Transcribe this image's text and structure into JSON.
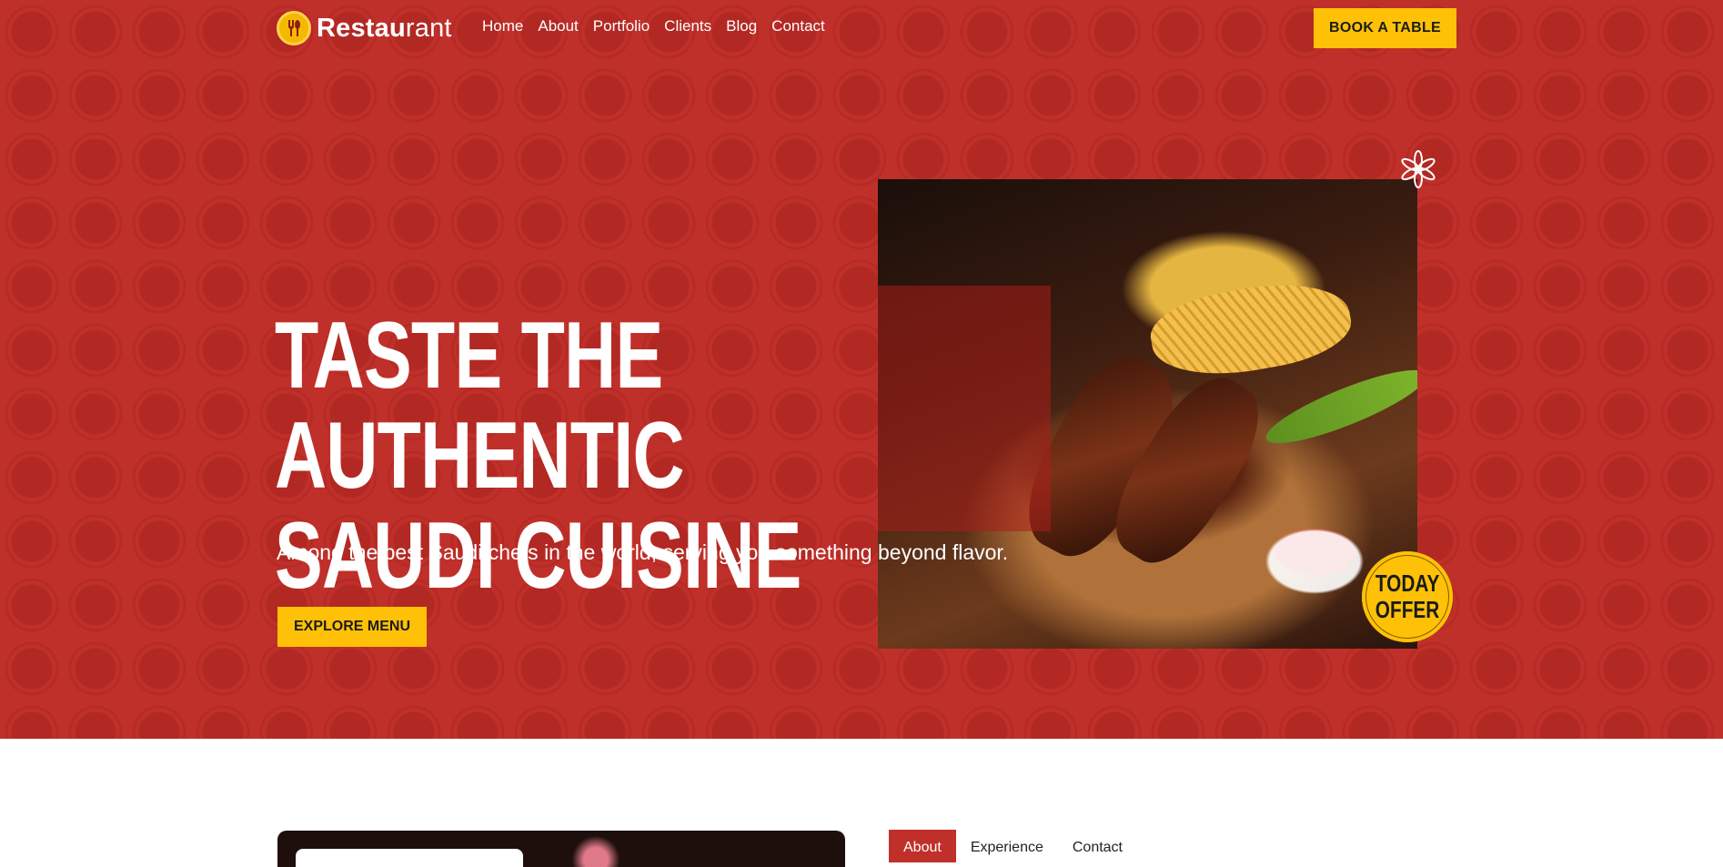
{
  "brand": {
    "name_bold": "Restau",
    "name_light": "rant",
    "logo_icon": "fork-spoon-icon",
    "colors": {
      "primary": "#c0302a",
      "accent": "#ffc107"
    }
  },
  "nav": {
    "items": [
      "Home",
      "About",
      "Portfolio",
      "Clients",
      "Blog",
      "Contact"
    ]
  },
  "header": {
    "cta_label": "BOOK A TABLE"
  },
  "hero": {
    "title_line1": "TASTE THE AUTHENTIC",
    "title_line2": "SAUDI CUISINE",
    "subtitle": "Among the best Saudi chefs in the world, serving you something beyond flavor.",
    "cta_label": "EXPLORE MENU",
    "badge_line1": "TODAY",
    "badge_line2": "OFFER",
    "decor_icon": "star-flower-icon"
  },
  "lower": {
    "tabs": [
      "About",
      "Experience",
      "Contact"
    ],
    "active_tab": "About"
  }
}
